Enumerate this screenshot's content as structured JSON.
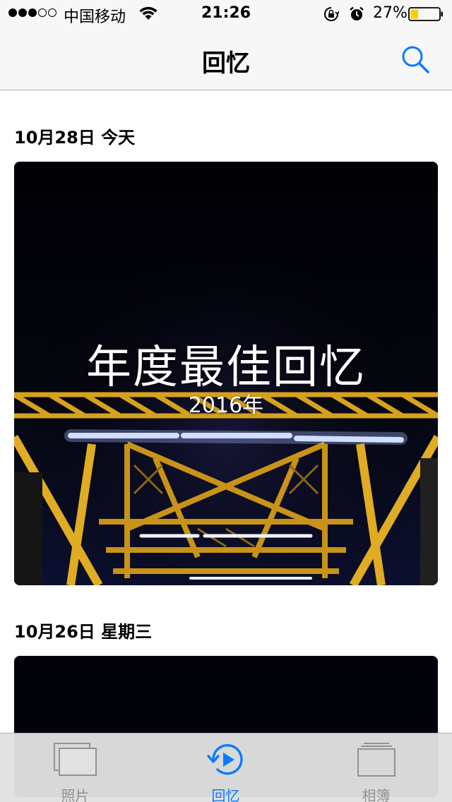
{
  "status_bar": {
    "carrier": "中国移动",
    "time": "21:26",
    "battery_percent": "27%",
    "battery_level": 0.27,
    "signal_bars_filled": 3,
    "signal_bars_total": 5,
    "icons": [
      "wifi-icon",
      "rotation-lock-icon",
      "alarm-icon",
      "battery-icon"
    ]
  },
  "nav": {
    "title": "回忆",
    "search_icon": "search-icon"
  },
  "sections": [
    {
      "date": "10月28日 今天",
      "memory_title": "年度最佳回忆",
      "memory_subtitle": "2016年"
    },
    {
      "date": "10月26日 星期三"
    }
  ],
  "tabs": [
    {
      "label": "照片",
      "icon": "photos-icon",
      "active": false
    },
    {
      "label": "回忆",
      "icon": "memories-icon",
      "active": true
    },
    {
      "label": "相簿",
      "icon": "albums-icon",
      "active": false
    }
  ],
  "colors": {
    "accent": "#0a7aff",
    "inactive_tab": "#929292",
    "bar_background": "#f7f7f7",
    "battery_fill": "#ffcc00"
  }
}
